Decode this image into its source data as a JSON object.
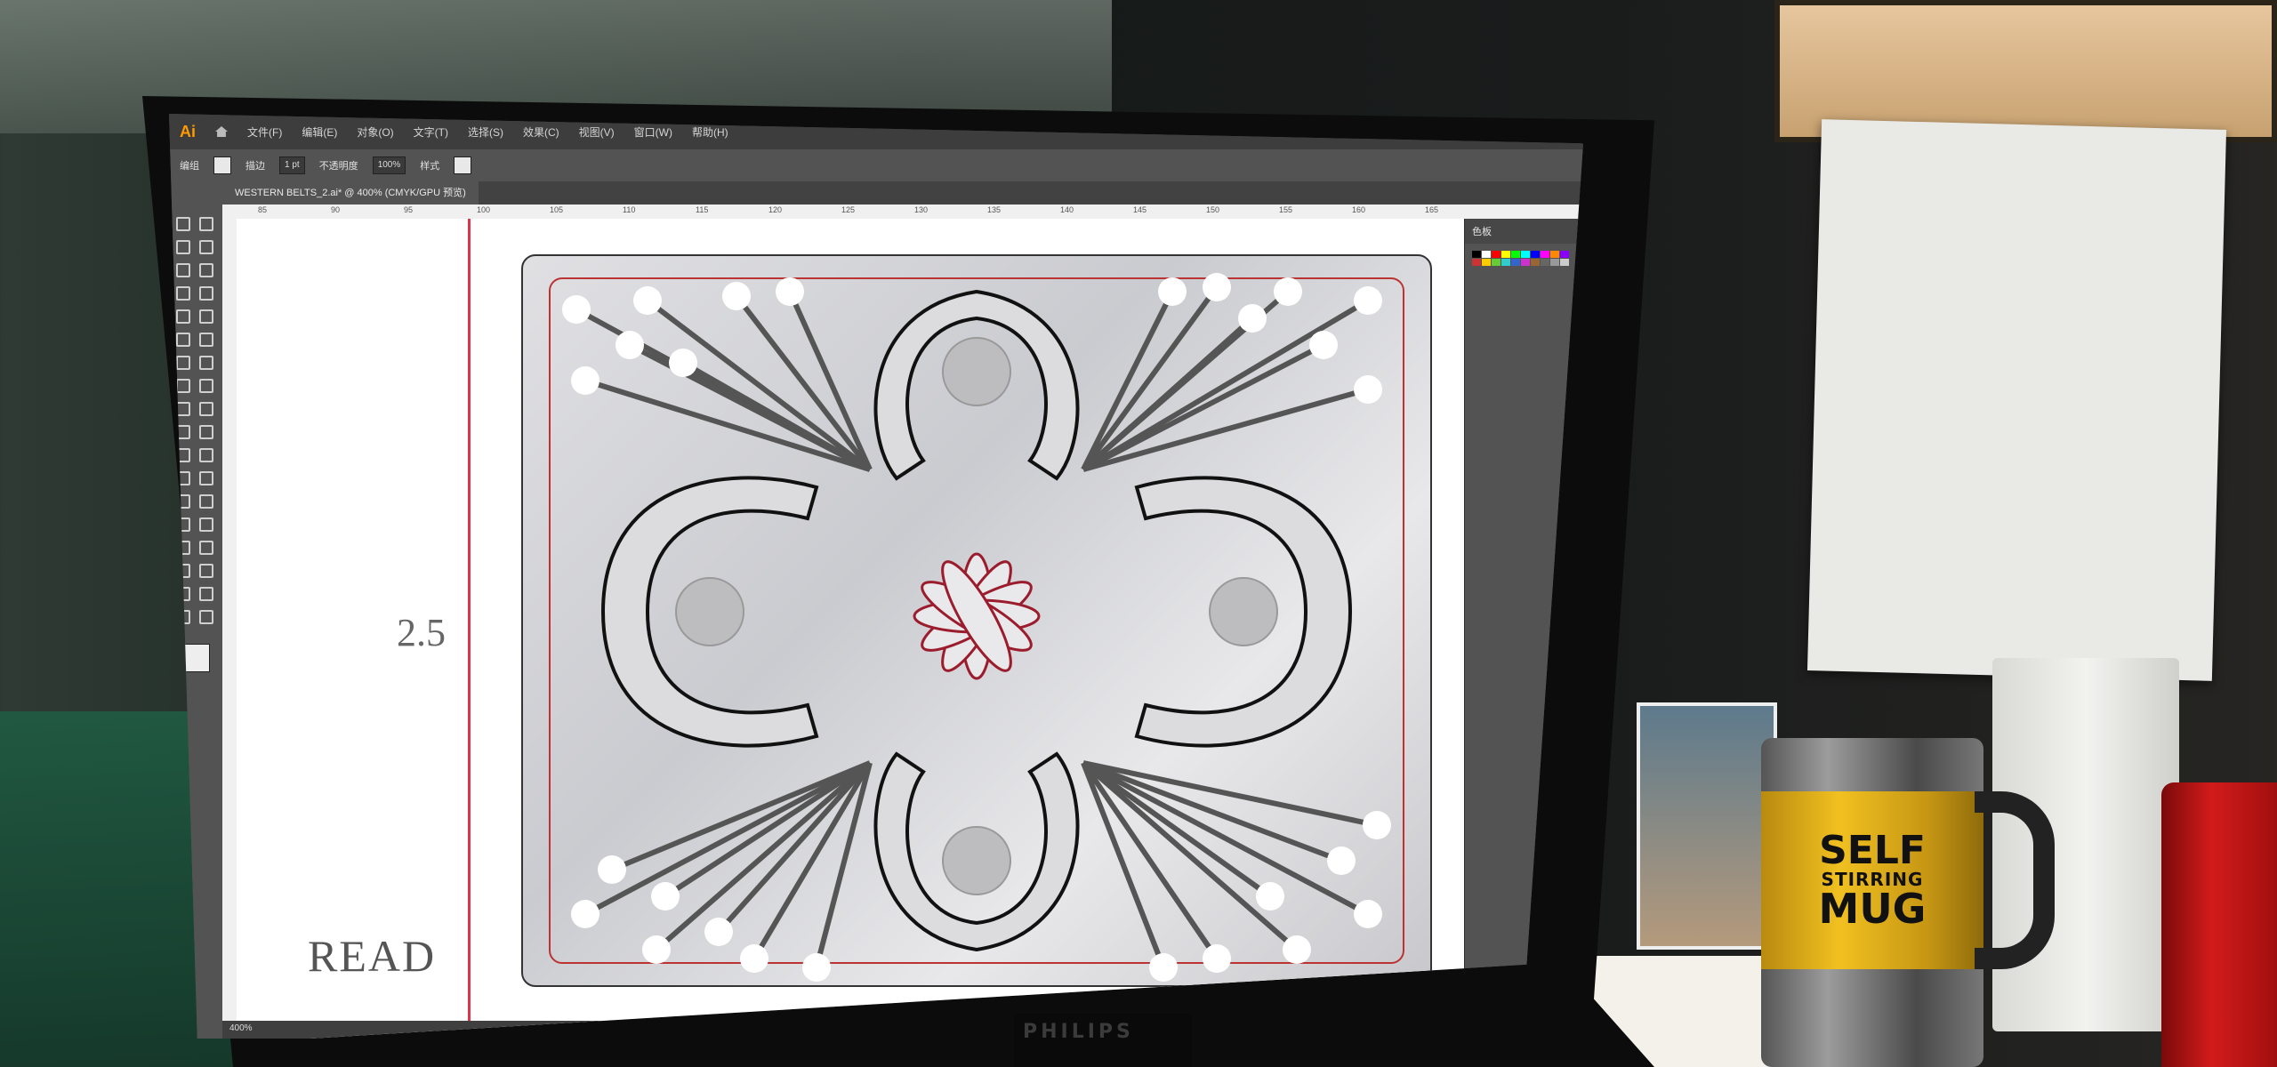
{
  "app": {
    "logo": "Ai"
  },
  "menu": [
    "文件(F)",
    "编辑(E)",
    "对象(O)",
    "文字(T)",
    "选择(S)",
    "效果(C)",
    "视图(V)",
    "窗口(W)",
    "帮助(H)"
  ],
  "control_bar": {
    "selection_label": "编组",
    "stroke_label": "描边",
    "stroke_value": "1 pt",
    "opacity_label": "不透明度",
    "opacity_value": "100%",
    "style_label": "样式"
  },
  "document_tab": "WESTERN BELTS_2.ai* @ 400% (CMYK/GPU 预览)",
  "ruler_ticks": [
    "85",
    "90",
    "95",
    "100",
    "105",
    "110",
    "115",
    "120",
    "125",
    "130",
    "135",
    "140",
    "145",
    "150",
    "155",
    "160",
    "165"
  ],
  "canvas_text": {
    "number": "2.5",
    "word": "READ"
  },
  "panels": {
    "swatches_title": "色板"
  },
  "status_bar": {
    "zoom": "400%"
  },
  "monitor_brand": "PHILIPS",
  "mug_text": {
    "line1": "SELF",
    "line2": "STIRRING",
    "line3": "MUG"
  },
  "colors": {
    "accent": "#e0344a",
    "ui_dark": "#535353",
    "mug_yellow": "#f1c020"
  },
  "swatch_colors": [
    "#000000",
    "#ffffff",
    "#ff0000",
    "#ffff00",
    "#00ff00",
    "#00ffff",
    "#0000ff",
    "#ff00ff",
    "#ff8800",
    "#8800ff",
    "#cc3333",
    "#ffcc00",
    "#66cc33",
    "#33cccc",
    "#3366cc",
    "#cc33cc",
    "#996633",
    "#666666",
    "#999999",
    "#cccccc"
  ]
}
